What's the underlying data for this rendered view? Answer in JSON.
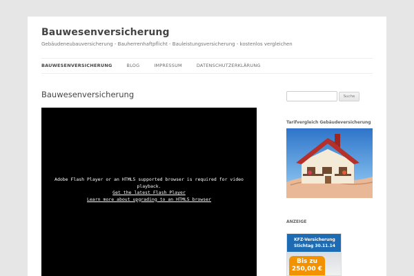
{
  "site": {
    "title": "Bauwesenversicherung",
    "description": "Gebäudeneubauversicherung - Bauherrenhaftpflicht - Bauleistungsversicherung - kostenlos vergleichen"
  },
  "nav": {
    "items": [
      {
        "label": "Bauwesenversicherung",
        "current": true
      },
      {
        "label": "Blog"
      },
      {
        "label": "Impressum"
      },
      {
        "label": "Datenschutzerklärung"
      }
    ]
  },
  "main": {
    "title": "Bauwesenversicherung",
    "video": {
      "message": "Adobe Flash Player or an HTML5 supported browser is required for video playback.",
      "link1": "Get the latest Flash Player",
      "link2": "Learn more about upgrading to an HTML5 browser"
    }
  },
  "sidebar": {
    "search": {
      "button": "Suche",
      "value": ""
    },
    "widget1_title": "Tarifvergleich Gebäudeversicherung",
    "widget2_title": "ANZEIGE",
    "ad": {
      "line1": "KFZ-Versicherung",
      "line2": "Stichtag 30.11.14",
      "badge1": "Bis zu",
      "badge2": "250,00 €"
    }
  }
}
